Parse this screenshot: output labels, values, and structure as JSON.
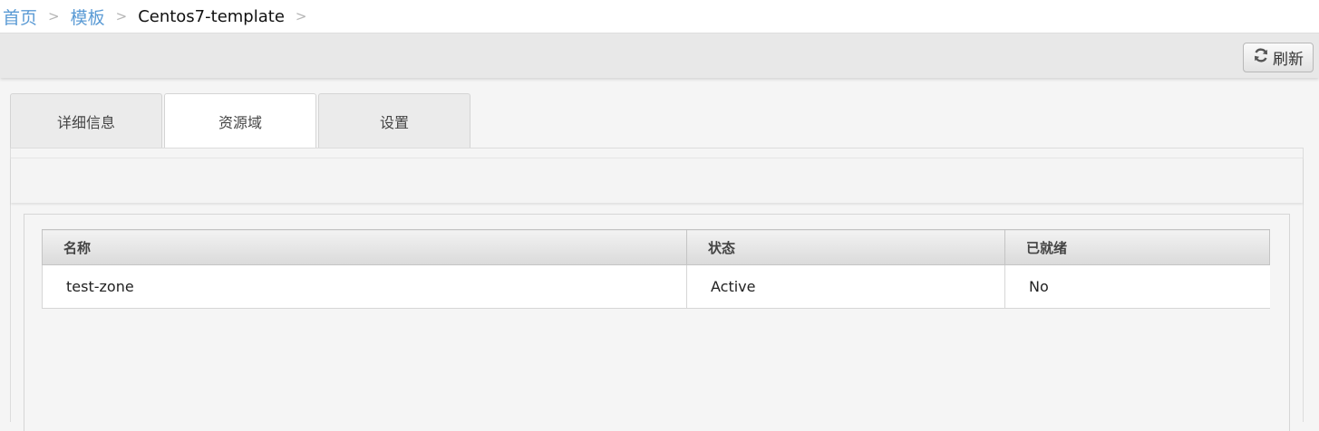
{
  "breadcrumb": {
    "home": "首页",
    "templates": "模板",
    "current": "Centos7-template",
    "separator": ">"
  },
  "toolbar": {
    "refresh_label": "刷新",
    "refresh_icon": "refresh-icon"
  },
  "tabs": [
    {
      "label": "详细信息",
      "active": false
    },
    {
      "label": "资源域",
      "active": true
    },
    {
      "label": "设置",
      "active": false
    }
  ],
  "grid": {
    "columns": [
      "名称",
      "状态",
      "已就绪"
    ],
    "rows": [
      {
        "name": "test-zone",
        "state": "Active",
        "ready": "No"
      }
    ]
  }
}
